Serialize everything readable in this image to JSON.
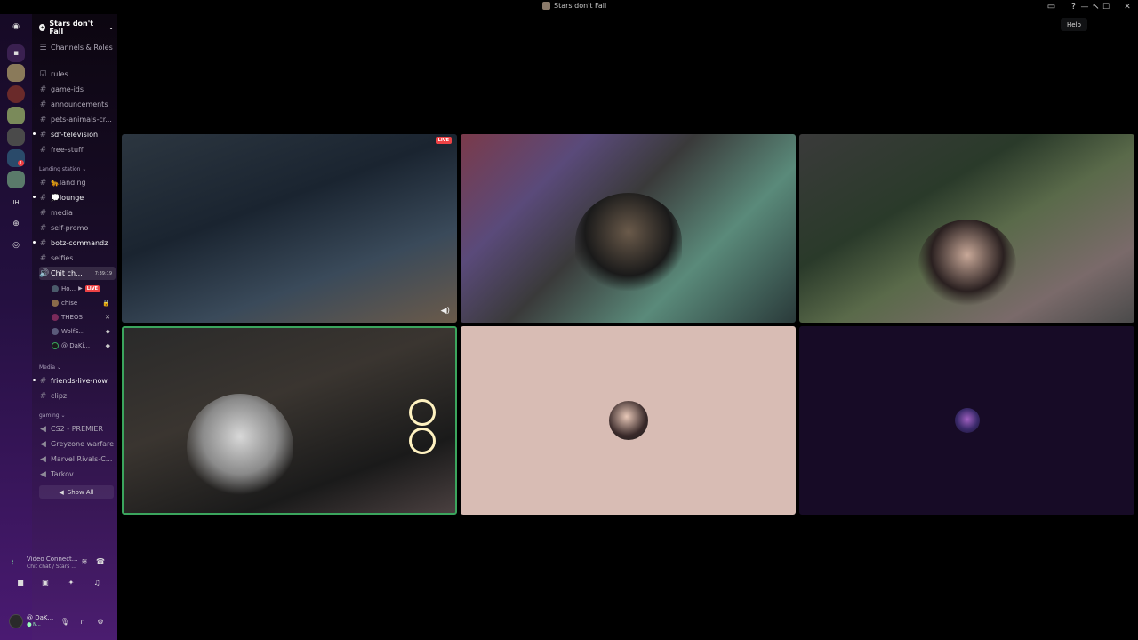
{
  "window": {
    "title": "Stars don't Fall",
    "help_tooltip": "Help"
  },
  "server": {
    "name": "Stars don't Fall",
    "channels_roles": "Channels & Roles"
  },
  "channels_top": [
    {
      "name": "rules",
      "icon": "rules-icon",
      "bold": false
    },
    {
      "name": "game-ids",
      "icon": "hash-icon",
      "bold": false
    },
    {
      "name": "announcements",
      "icon": "hash-icon",
      "bold": false
    },
    {
      "name": "pets-animals-cr...",
      "icon": "hash-icon",
      "bold": false
    },
    {
      "name": "sdf-television",
      "icon": "hash-icon",
      "bold": true
    },
    {
      "name": "free-stuff",
      "icon": "hash-icon",
      "bold": false
    }
  ],
  "category_landing": "Landing station",
  "channels_landing": [
    {
      "name": "🐆landing",
      "bold": false
    },
    {
      "name": "💭lounge",
      "bold": true
    },
    {
      "name": "media",
      "bold": false
    },
    {
      "name": "self-promo",
      "bold": false
    },
    {
      "name": "botz-commandz",
      "bold": true
    },
    {
      "name": "selfies",
      "bold": false
    }
  ],
  "voice_channel": {
    "name": "Chit ch...",
    "timer": "7:39:19"
  },
  "voice_users": [
    {
      "name": "Ho...",
      "live": "LIVE",
      "indicator": ""
    },
    {
      "name": "chise",
      "live": "",
      "indicator": "🔒"
    },
    {
      "name": "THEOS",
      "live": "",
      "indicator": "✕"
    },
    {
      "name": "WolfS...",
      "live": "",
      "indicator": "◆"
    },
    {
      "name": "@ DaKi...",
      "live": "",
      "indicator": "◆"
    }
  ],
  "category_media": "Media",
  "channels_media": [
    {
      "name": "friends-live-now",
      "bold": true
    },
    {
      "name": "clipz",
      "bold": false
    }
  ],
  "category_gaming": "gaming",
  "channels_gaming": [
    {
      "name": "CS2 - PREMIER"
    },
    {
      "name": "Greyzone warfare"
    },
    {
      "name": "Marvel Rivals-C..."
    },
    {
      "name": "Tarkov"
    }
  ],
  "show_all": "Show All",
  "voice_panel": {
    "status": "Video Connect...",
    "location": "Chit chat / Stars ..."
  },
  "user_panel": {
    "name": "@ DaK...",
    "status": "⬤ N..."
  },
  "video_tiles": [
    {
      "live": "LIVE"
    },
    {
      "live": ""
    },
    {
      "live": ""
    },
    {
      "live": ""
    },
    {
      "live": ""
    },
    {
      "live": ""
    }
  ],
  "rail_badge": "1",
  "colors": {
    "accent": "#5865f2",
    "speaking": "#3ba55d",
    "live": "#ed4245"
  }
}
